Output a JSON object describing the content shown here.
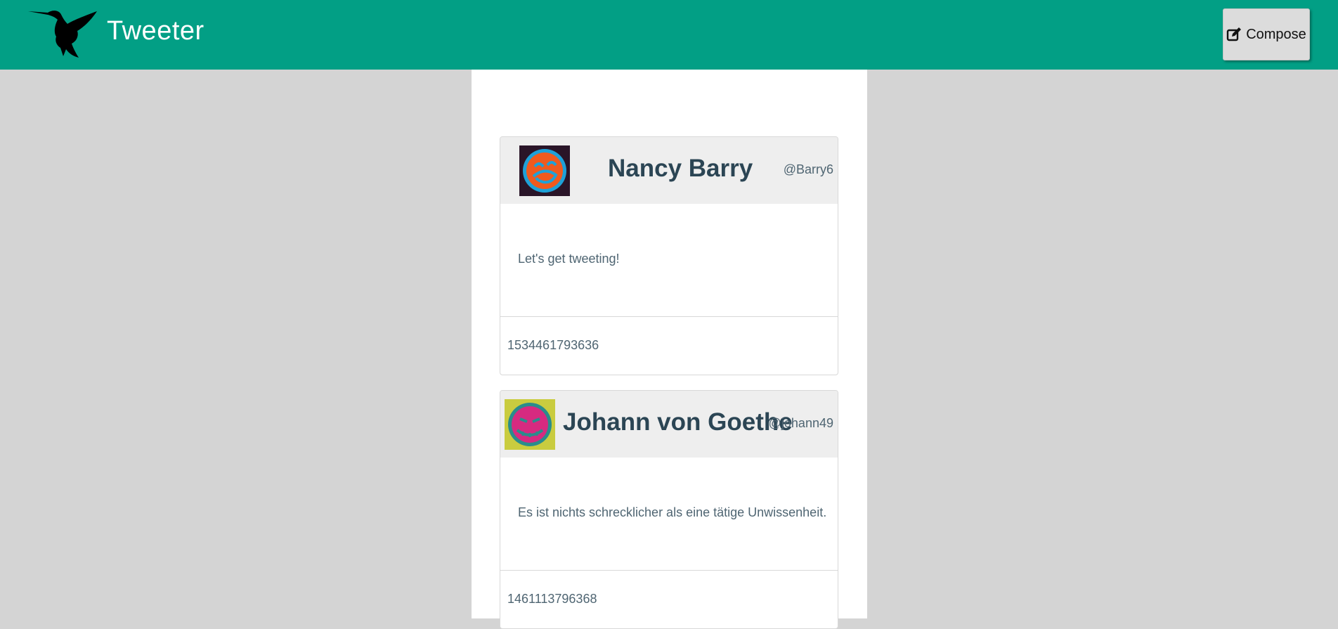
{
  "navbar": {
    "brand": "Tweeter",
    "logo_icon": "hummingbird-icon",
    "compose": {
      "label": "Compose",
      "icon": "edit-icon"
    },
    "colors": {
      "background": "#029f85",
      "brand_text": "#ffffff"
    }
  },
  "page": {
    "background": "#d4d4d4",
    "column_background": "#ffffff"
  },
  "tweets": [
    {
      "name": "Nancy Barry",
      "handle": "@Barry6",
      "text": "Let's get tweeting!",
      "timestamp": "1534461793636",
      "avatar": {
        "icon": "avatar-icon",
        "background": "#2a1528",
        "face": "#f05a1e",
        "ring": "#1ea1d8"
      }
    },
    {
      "name": "Johann von Goethe",
      "handle": "@johann49",
      "text": "Es ist nichts schrecklicher als eine tätige Unwissenheit.",
      "timestamp": "1461113796368",
      "avatar": {
        "icon": "avatar-icon",
        "background": "#c9cc3f",
        "face": "#d62a80",
        "ring": "#2a8c8c"
      }
    }
  ]
}
